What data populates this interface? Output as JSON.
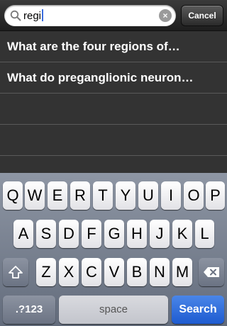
{
  "search": {
    "query": "regi",
    "clear_glyph": "×",
    "cancel_label": "Cancel"
  },
  "results": [
    {
      "label": "What are the four regions of…"
    },
    {
      "label": "What do preganglionic neuron…"
    }
  ],
  "keyboard": {
    "row1": [
      "Q",
      "W",
      "E",
      "R",
      "T",
      "Y",
      "U",
      "I",
      "O",
      "P"
    ],
    "row2": [
      "A",
      "S",
      "D",
      "F",
      "G",
      "H",
      "J",
      "K",
      "L"
    ],
    "row3": [
      "Z",
      "X",
      "C",
      "V",
      "B",
      "N",
      "M"
    ],
    "numbers_label": ".?123",
    "space_label": "space",
    "search_label": "Search",
    "shift_icon": "shift-icon",
    "delete_icon": "delete-icon"
  },
  "colors": {
    "accent": "#2a66dc",
    "results_bg": "#333333"
  }
}
